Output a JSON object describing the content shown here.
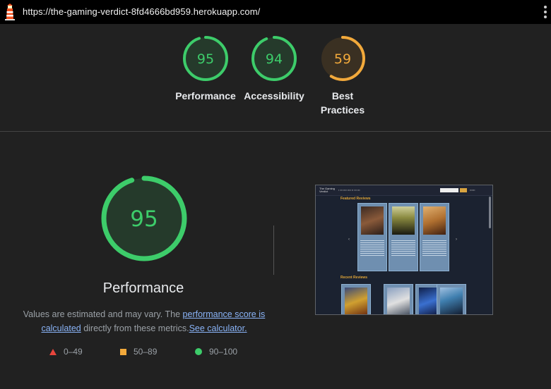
{
  "topbar": {
    "url": "https://the-gaming-verdict-8fd4666bd959.herokuapp.com/"
  },
  "summary": [
    {
      "score": "95",
      "label": "Performance",
      "color": "#3dcc6a",
      "fraction": 0.95
    },
    {
      "score": "94",
      "label": "Accessibility",
      "color": "#3dcc6a",
      "fraction": 0.94
    },
    {
      "score": "59",
      "label_line1": "Best",
      "label_line2": "Practices",
      "color": "#f2a93b",
      "fraction": 0.59
    }
  ],
  "main": {
    "score": "95",
    "score_fraction": 0.95,
    "title": "Performance",
    "desc_text1": "Values are estimated and may vary. The ",
    "desc_link1": "performance score is calculated",
    "desc_text2": " directly from these metrics.",
    "desc_link2": "See calculator.",
    "legend": [
      {
        "range": "0–49",
        "color": "#e8453c"
      },
      {
        "range": "50–89",
        "color": "#f2a93b"
      },
      {
        "range": "90–100",
        "color": "#3dcc6a"
      }
    ]
  },
  "thumbnail": {
    "site_name_line1": "The Gaming",
    "site_name_line2": "Verdict",
    "featured_heading": "Featured Reviews",
    "recent_heading": "Recent Reviews"
  },
  "colors": {
    "background": "#212121",
    "green": "#3dcc6a",
    "orange": "#f2a93b",
    "red": "#e8453c",
    "link": "#8ab4f8"
  }
}
